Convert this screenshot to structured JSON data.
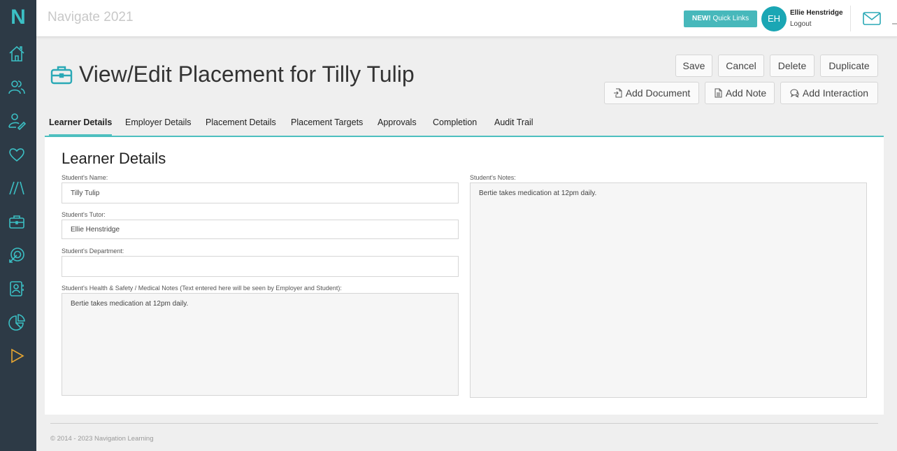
{
  "brand": {
    "logo_letter": "N",
    "accent": "#47b8bb",
    "sidebar_bg": "#2d3a46"
  },
  "sidebar": {
    "items": [
      {
        "name": "home-icon",
        "color": "#3bbfc4"
      },
      {
        "name": "users-icon",
        "color": "#3bbfc4"
      },
      {
        "name": "user-edit-icon",
        "color": "#3bbfc4"
      },
      {
        "name": "heart-icon",
        "color": "#3bbfc4"
      },
      {
        "name": "slashes-icon",
        "color": "#3bbfc4"
      },
      {
        "name": "briefcase-icon",
        "color": "#3bbfc4"
      },
      {
        "name": "target-icon",
        "color": "#3bbfc4"
      },
      {
        "name": "contacts-icon",
        "color": "#3bbfc4"
      },
      {
        "name": "pie-chart-icon",
        "color": "#3bbfc4"
      },
      {
        "name": "play-icon",
        "color": "#e6a532"
      }
    ]
  },
  "header": {
    "app_title": "Navigate 2021",
    "quick_links_badge": "NEW!",
    "quick_links_label": "Quick Links",
    "avatar_initials": "EH",
    "user_name": "Ellie Henstridge",
    "logout_label": "Logout",
    "mail_icon": "mail-icon"
  },
  "page": {
    "title": "View/Edit Placement for Tilly Tulip",
    "title_icon": "briefcase-icon",
    "actions": {
      "save": "Save",
      "cancel": "Cancel",
      "delete": "Delete",
      "duplicate": "Duplicate",
      "add_document": "Add Document",
      "add_note": "Add Note",
      "add_interaction": "Add Interaction"
    }
  },
  "tabs": [
    {
      "label": "Learner Details",
      "active": true
    },
    {
      "label": "Employer Details",
      "active": false
    },
    {
      "label": "Placement Details",
      "active": false
    },
    {
      "label": "Placement Targets",
      "active": false
    },
    {
      "label": "Approvals",
      "active": false
    },
    {
      "label": "Completion",
      "active": false
    },
    {
      "label": "Audit Trail",
      "active": false
    }
  ],
  "learner": {
    "section_title": "Learner Details",
    "name_label": "Student's Name:",
    "name_value": "Tilly Tulip",
    "tutor_label": "Student's Tutor:",
    "tutor_value": "Ellie Henstridge",
    "department_label": "Student's Department:",
    "department_value": "",
    "health_label": "Student's Health & Safety / Medical Notes (Text entered here will be seen by Employer and Student):",
    "health_value": "Bertie takes medication at 12pm daily.",
    "notes_label": "Student's Notes:",
    "notes_value": "Bertie takes medication at 12pm daily."
  },
  "footer": {
    "copyright": "© 2014 - 2023 Navigation Learning"
  }
}
